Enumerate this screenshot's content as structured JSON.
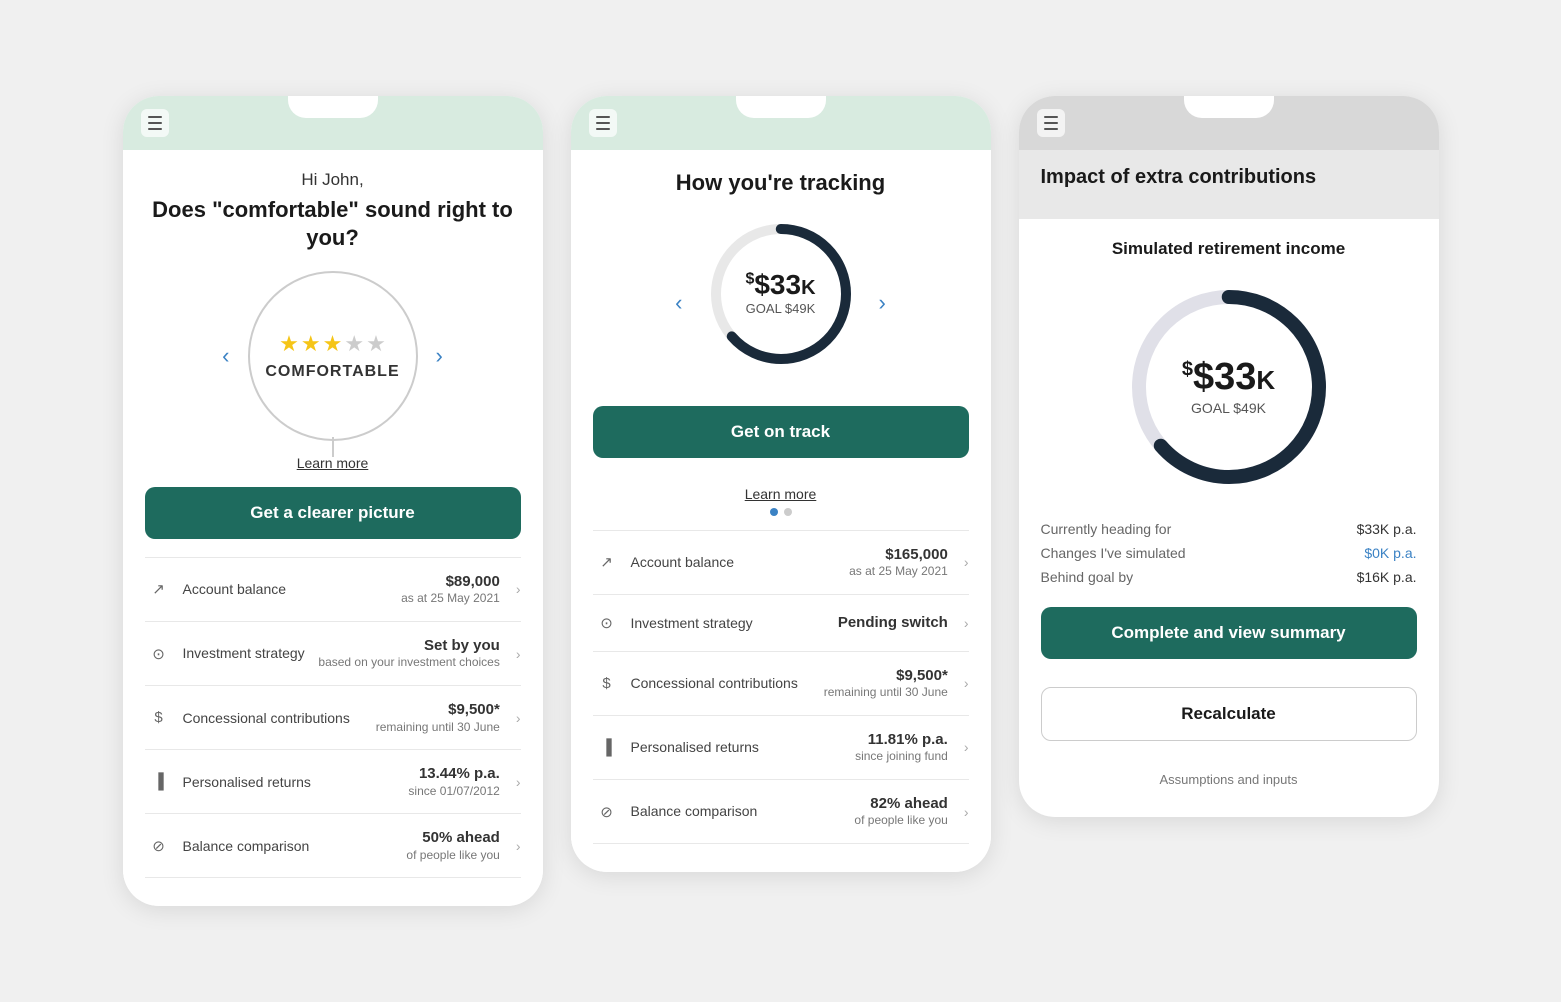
{
  "phone1": {
    "greeting": "Hi John,",
    "question": "Does \"comfortable\" sound right to you?",
    "stars": [
      true,
      true,
      true,
      false,
      false
    ],
    "comfort_label": "COMFORTABLE",
    "learn_more": "Learn more",
    "cta_label": "Get a clearer picture",
    "rows": [
      {
        "icon": "chart-line",
        "label": "Account balance",
        "main_val": "$89,000",
        "sub_val": "as at 25 May 2021"
      },
      {
        "icon": "strategy",
        "label": "Investment strategy",
        "main_val": "Set by you",
        "sub_val": "based on your investment choices"
      },
      {
        "icon": "dollar",
        "label": "Concessional contributions",
        "main_val": "$9,500*",
        "sub_val": "remaining until 30 June"
      },
      {
        "icon": "bar-chart",
        "label": "Personalised returns",
        "main_val": "13.44% p.a.",
        "sub_val": "since 01/07/2012"
      },
      {
        "icon": "balance",
        "label": "Balance comparison",
        "main_val": "50% ahead",
        "sub_val": "of people like you"
      }
    ]
  },
  "phone2": {
    "tracking_title": "How you're tracking",
    "amount": "$33",
    "amount_k": "K",
    "goal": "GOAL $49K",
    "cta_label": "Get on track",
    "learn_more": "Learn more",
    "dots": [
      true,
      false
    ],
    "rows": [
      {
        "icon": "chart-line",
        "label": "Account balance",
        "main_val": "$165,000",
        "sub_val": "as at 25 May 2021"
      },
      {
        "icon": "strategy",
        "label": "Investment strategy",
        "main_val": "Pending switch",
        "sub_val": ""
      },
      {
        "icon": "dollar",
        "label": "Concessional contributions",
        "main_val": "$9,500*",
        "sub_val": "remaining until 30 June"
      },
      {
        "icon": "bar-chart",
        "label": "Personalised returns",
        "main_val": "11.81% p.a.",
        "sub_val": "since joining fund"
      },
      {
        "icon": "balance",
        "label": "Balance comparison",
        "main_val": "82% ahead",
        "sub_val": "of people like you"
      }
    ]
  },
  "phone3": {
    "top_title": "Impact of extra contributions",
    "sim_title": "Simulated retirement income",
    "amount": "$33",
    "amount_k": "K",
    "goal": "GOAL $49K",
    "stats": [
      {
        "label": "Currently heading for",
        "value": "$33K p.a.",
        "color": "normal"
      },
      {
        "label": "Changes I've simulated",
        "value": "$0K p.a.",
        "color": "blue"
      },
      {
        "label": "Behind goal by",
        "value": "$16K p.a.",
        "color": "normal"
      }
    ],
    "cta_label": "Complete and view summary",
    "recalculate_label": "Recalculate",
    "assumptions_label": "Assumptions and inputs"
  }
}
